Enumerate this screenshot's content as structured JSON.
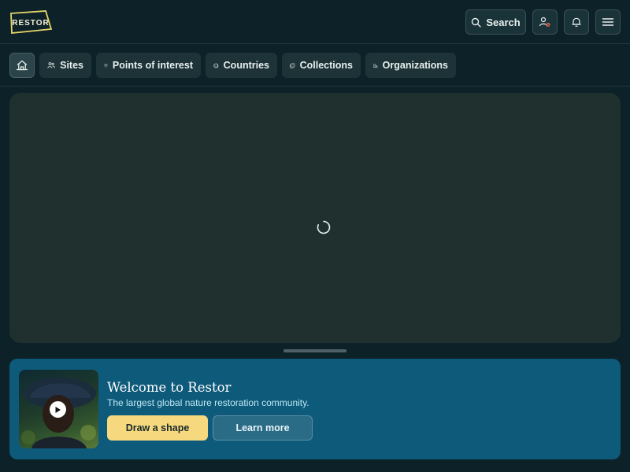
{
  "header": {
    "logo_text": "RESTOR",
    "search_label": "Search",
    "icons": {
      "search": "search-icon",
      "user": "user-icon",
      "bell": "bell-icon",
      "menu": "hamburger-menu-icon"
    }
  },
  "nav": {
    "home_icon": "home-icon",
    "items": [
      {
        "label": "Sites",
        "icon": "people-icon"
      },
      {
        "label": "Points of interest",
        "icon": "map-pin-icon"
      },
      {
        "label": "Countries",
        "icon": "globe-icon"
      },
      {
        "label": "Collections",
        "icon": "collection-icon"
      },
      {
        "label": "Organizations",
        "icon": "organization-icon"
      }
    ]
  },
  "map": {
    "state_icon": "loading-spinner-icon"
  },
  "welcome": {
    "title": "Welcome to Restor",
    "subtitle": "The largest global nature restoration community.",
    "draw_button": "Draw a shape",
    "learn_button": "Learn more",
    "video_icon": "play-icon"
  },
  "colors": {
    "background": "#0c2128",
    "accent_yellow": "#f6d97e",
    "banner_blue": "#0e5a7a",
    "map_surface": "#1f302f"
  }
}
